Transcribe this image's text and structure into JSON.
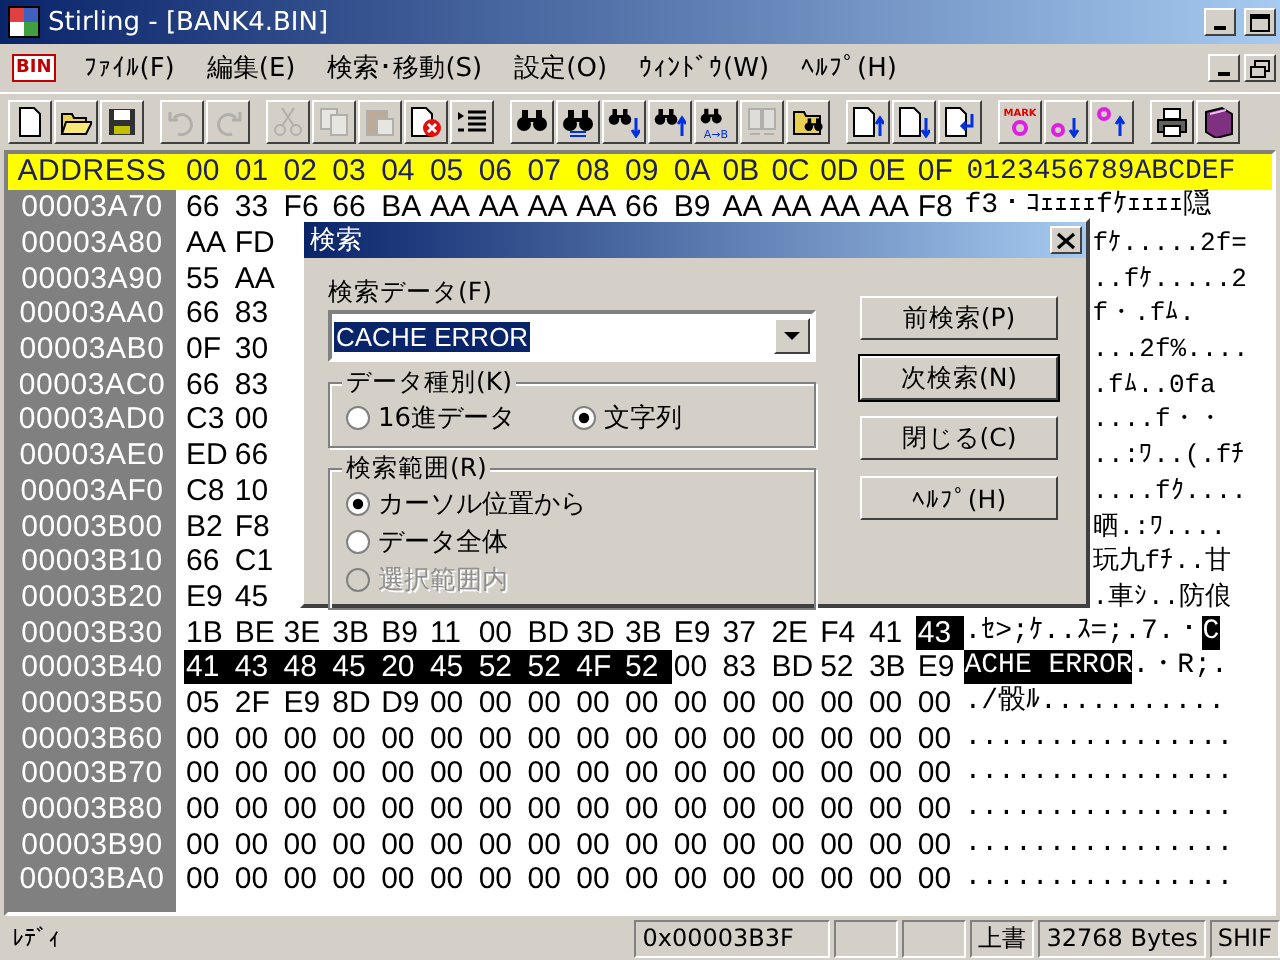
{
  "window": {
    "title": "Stirling - [BANK4.BIN]"
  },
  "menubar": {
    "doc_badge": "BIN",
    "items": [
      "ﾌｧｲﾙ(F)",
      "編集(E)",
      "検索･移動(S)",
      "設定(O)",
      "ｳｨﾝﾄﾞｳ(W)",
      "ﾍﾙﾌﾟ(H)"
    ]
  },
  "toolbar": {
    "groups": [
      {
        "buttons": [
          {
            "kind": "new",
            "disabled": false
          },
          {
            "kind": "open",
            "disabled": false
          },
          {
            "kind": "save",
            "disabled": false
          }
        ]
      },
      {
        "buttons": [
          {
            "kind": "undo",
            "disabled": true
          },
          {
            "kind": "redo",
            "disabled": true
          }
        ]
      },
      {
        "buttons": [
          {
            "kind": "cut",
            "disabled": true
          },
          {
            "kind": "copy",
            "disabled": true
          },
          {
            "kind": "paste",
            "disabled": true
          },
          {
            "kind": "delete",
            "disabled": false
          },
          {
            "kind": "list",
            "disabled": false
          }
        ]
      },
      {
        "buttons": [
          {
            "kind": "find",
            "disabled": false
          },
          {
            "kind": "find-replace",
            "disabled": false
          },
          {
            "kind": "find-down",
            "disabled": false
          },
          {
            "kind": "find-up",
            "disabled": false
          },
          {
            "kind": "find-ab",
            "disabled": false,
            "label": "A→B"
          },
          {
            "kind": "compare",
            "disabled": true
          },
          {
            "kind": "folder-find",
            "disabled": false
          }
        ]
      },
      {
        "buttons": [
          {
            "kind": "doc-up",
            "disabled": false
          },
          {
            "kind": "doc-down",
            "disabled": false
          },
          {
            "kind": "doc-return",
            "disabled": false
          }
        ]
      },
      {
        "buttons": [
          {
            "kind": "mark",
            "disabled": false,
            "label": "MARK"
          },
          {
            "kind": "mark-down",
            "disabled": false
          },
          {
            "kind": "mark-up",
            "disabled": false
          }
        ]
      },
      {
        "buttons": [
          {
            "kind": "print",
            "disabled": false
          },
          {
            "kind": "book",
            "disabled": false
          }
        ]
      }
    ]
  },
  "editor": {
    "header": {
      "address": "ADDRESS",
      "columns": [
        "00",
        "01",
        "02",
        "03",
        "04",
        "05",
        "06",
        "07",
        "08",
        "09",
        "0A",
        "0B",
        "0C",
        "0D",
        "0E",
        "0F"
      ],
      "ascii": "0123456789ABCDEF"
    },
    "rows": [
      {
        "kind": "full",
        "address": "00003A70",
        "hex_groups": [
          {
            "selected": false,
            "bytes": [
              "66",
              "33",
              "F6",
              "66",
              "BA",
              "AA",
              "AA",
              "AA",
              "AA",
              "66",
              "B9",
              "AA",
              "AA",
              "AA",
              "AA",
              "F8"
            ]
          }
        ],
        "ascii_groups": [
          {
            "selected": false,
            "text": "f3・ｺｪｪｪｪfｹｪｪｪｪ隠"
          }
        ]
      },
      {
        "kind": "covered",
        "address": "00003A80",
        "hex": [
          "AA",
          "FD"
        ],
        "ascii": "fｹ.....2f="
      },
      {
        "kind": "covered",
        "address": "00003A90",
        "hex": [
          "55",
          "AA"
        ],
        "ascii": "..fｹ.....2"
      },
      {
        "kind": "covered",
        "address": "00003AA0",
        "hex": [
          "66",
          "83"
        ],
        "ascii": "f・.fﾑ."
      },
      {
        "kind": "covered",
        "address": "00003AB0",
        "hex": [
          "0F",
          "30"
        ],
        "ascii": "...2f%...."
      },
      {
        "kind": "covered",
        "address": "00003AC0",
        "hex": [
          "66",
          "83"
        ],
        "ascii": ".fﾑ..0fa"
      },
      {
        "kind": "covered",
        "address": "00003AD0",
        "hex": [
          "C3",
          "00"
        ],
        "ascii": "....f・・"
      },
      {
        "kind": "covered",
        "address": "00003AE0",
        "hex": [
          "ED",
          "66"
        ],
        "ascii": "..:ﾜ..(.fﾁ"
      },
      {
        "kind": "covered",
        "address": "00003AF0",
        "hex": [
          "C8",
          "10"
        ],
        "ascii": "....fｸ...."
      },
      {
        "kind": "covered",
        "address": "00003B00",
        "hex": [
          "B2",
          "F8"
        ],
        "ascii": "晒.:ﾜ...."
      },
      {
        "kind": "covered",
        "address": "00003B10",
        "hex": [
          "66",
          "C1"
        ],
        "ascii": "玩九fﾁ..甘"
      },
      {
        "kind": "covered",
        "address": "00003B20",
        "hex": [
          "E9",
          "45"
        ],
        "ascii": ".車ｼ..防俍"
      },
      {
        "kind": "full",
        "address": "00003B30",
        "hex_groups": [
          {
            "selected": false,
            "bytes": [
              "1B",
              "BE",
              "3E",
              "3B",
              "B9",
              "11",
              "00",
              "BD",
              "3D",
              "3B",
              "E9",
              "37",
              "2E",
              "F4",
              "41"
            ]
          },
          {
            "selected": true,
            "bytes": [
              "43"
            ]
          }
        ],
        "ascii_groups": [
          {
            "selected": false,
            "text": ".ｾ>;ｹ..ｽ=;.7.・"
          },
          {
            "selected": true,
            "text": "C"
          }
        ]
      },
      {
        "kind": "full",
        "address": "00003B40",
        "hex_groups": [
          {
            "selected": true,
            "bytes": [
              "41",
              "43",
              "48",
              "45",
              "20",
              "45",
              "52",
              "52",
              "4F",
              "52"
            ]
          },
          {
            "selected": false,
            "bytes": [
              "00",
              "83",
              "BD",
              "52",
              "3B",
              "E9"
            ]
          }
        ],
        "ascii_groups": [
          {
            "selected": true,
            "text": "ACHE ERROR"
          },
          {
            "selected": false,
            "text": ".・R;."
          }
        ]
      },
      {
        "kind": "full",
        "address": "00003B50",
        "hex_groups": [
          {
            "selected": false,
            "bytes": [
              "05",
              "2F",
              "E9",
              "8D",
              "D9",
              "00",
              "00",
              "00",
              "00",
              "00",
              "00",
              "00",
              "00",
              "00",
              "00",
              "00"
            ]
          }
        ],
        "ascii_groups": [
          {
            "selected": false,
            "text": "./骰ﾙ..........."
          }
        ]
      },
      {
        "kind": "full",
        "address": "00003B60",
        "hex_groups": [
          {
            "selected": false,
            "bytes": [
              "00",
              "00",
              "00",
              "00",
              "00",
              "00",
              "00",
              "00",
              "00",
              "00",
              "00",
              "00",
              "00",
              "00",
              "00",
              "00"
            ]
          }
        ],
        "ascii_groups": [
          {
            "selected": false,
            "text": "................"
          }
        ]
      },
      {
        "kind": "full",
        "address": "00003B70",
        "hex_groups": [
          {
            "selected": false,
            "bytes": [
              "00",
              "00",
              "00",
              "00",
              "00",
              "00",
              "00",
              "00",
              "00",
              "00",
              "00",
              "00",
              "00",
              "00",
              "00",
              "00"
            ]
          }
        ],
        "ascii_groups": [
          {
            "selected": false,
            "text": "................"
          }
        ]
      },
      {
        "kind": "full",
        "address": "00003B80",
        "hex_groups": [
          {
            "selected": false,
            "bytes": [
              "00",
              "00",
              "00",
              "00",
              "00",
              "00",
              "00",
              "00",
              "00",
              "00",
              "00",
              "00",
              "00",
              "00",
              "00",
              "00"
            ]
          }
        ],
        "ascii_groups": [
          {
            "selected": false,
            "text": "................"
          }
        ]
      },
      {
        "kind": "full",
        "address": "00003B90",
        "hex_groups": [
          {
            "selected": false,
            "bytes": [
              "00",
              "00",
              "00",
              "00",
              "00",
              "00",
              "00",
              "00",
              "00",
              "00",
              "00",
              "00",
              "00",
              "00",
              "00",
              "00"
            ]
          }
        ],
        "ascii_groups": [
          {
            "selected": false,
            "text": "................"
          }
        ]
      },
      {
        "kind": "full",
        "address": "00003BA0",
        "hex_groups": [
          {
            "selected": false,
            "bytes": [
              "00",
              "00",
              "00",
              "00",
              "00",
              "00",
              "00",
              "00",
              "00",
              "00",
              "00",
              "00",
              "00",
              "00",
              "00",
              "00"
            ]
          }
        ],
        "ascii_groups": [
          {
            "selected": false,
            "text": "................"
          }
        ]
      }
    ]
  },
  "status_bar": {
    "message": "ﾚﾃﾞｨ",
    "panes": [
      {
        "kind": "text",
        "text": "0x00003B3F"
      },
      {
        "kind": "blank"
      },
      {
        "kind": "blank"
      },
      {
        "kind": "text",
        "text": "上書"
      },
      {
        "kind": "text",
        "text": "32768 Bytes"
      },
      {
        "kind": "text",
        "text": "SHIF"
      }
    ]
  },
  "dialog": {
    "title": "検索",
    "search_label": "検索データ(F)",
    "search_value": "CACHE ERROR",
    "groups": [
      {
        "label": "データ種別(K)",
        "kind": "row",
        "options": [
          {
            "label": "16進データ",
            "selected": false,
            "disabled": false
          },
          {
            "label": "文字列",
            "selected": true,
            "disabled": false
          }
        ]
      },
      {
        "label": "検索範囲(R)",
        "kind": "column",
        "options": [
          {
            "label": "カーソル位置から",
            "selected": true,
            "disabled": false
          },
          {
            "label": "データ全体",
            "selected": false,
            "disabled": false
          },
          {
            "label": "選択範囲内",
            "selected": false,
            "disabled": true
          }
        ]
      }
    ],
    "buttons": [
      {
        "label": "前検索(P)",
        "default": false
      },
      {
        "label": "次検索(N)",
        "default": true
      },
      {
        "label": "閉じる(C)",
        "default": false
      },
      {
        "label": "ﾍﾙﾌﾟ(H)",
        "default": false
      }
    ]
  }
}
